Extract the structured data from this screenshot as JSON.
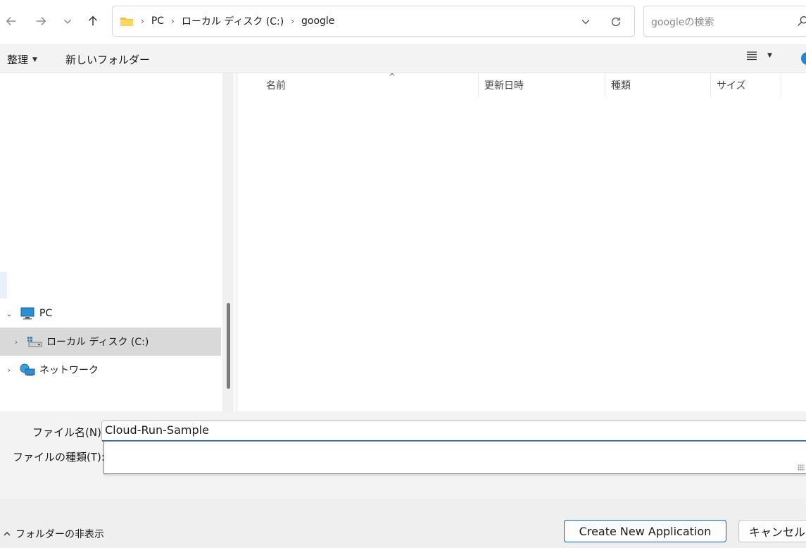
{
  "address": {
    "crumbs": [
      "PC",
      "ローカル ディスク (C:)",
      "google"
    ]
  },
  "search": {
    "placeholder": "googleの検索"
  },
  "commands": {
    "organize": "整理",
    "new_folder": "新しいフォルダー"
  },
  "nav": {
    "items": [
      {
        "label": "PC",
        "expander": "⌄",
        "icon": "computer-icon"
      },
      {
        "label": "ローカル ディスク (C:)",
        "expander": "›",
        "icon": "drive-icon",
        "selected": true
      },
      {
        "label": "ネットワーク",
        "expander": "›",
        "icon": "network-icon"
      }
    ]
  },
  "columns": [
    "名前",
    "更新日時",
    "種類",
    "サイズ"
  ],
  "form": {
    "filename_label": "ファイル名(N):",
    "filename_value": "Cloud-Run-Sample",
    "filetype_label": "ファイルの種類(T):"
  },
  "footer": {
    "toggle_folders": "フォルダーの非表示",
    "primary_button": "Create New Application",
    "cancel_button": "キャンセル"
  },
  "colors": {
    "accent": "#0067c0",
    "folder": "#f3c13a",
    "selected": "#d9d9d9"
  }
}
